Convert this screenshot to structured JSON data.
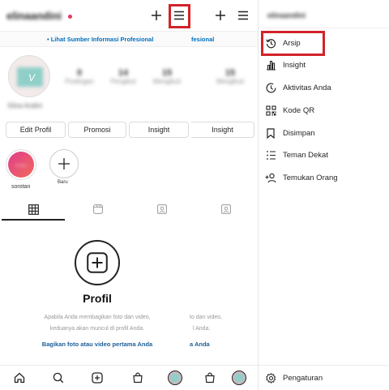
{
  "header": {
    "username": "elinaandini",
    "username_right": "elinaandini"
  },
  "banner": {
    "text": "• Lihat Sumber Informasi Profesional",
    "text_partial": "fesional"
  },
  "profile": {
    "name": "Elina Andini",
    "stats": [
      {
        "num": "0",
        "label": "Postingan"
      },
      {
        "num": "14",
        "label": "Pengikut"
      },
      {
        "num": "15",
        "label": "Mengikuti"
      },
      {
        "num": "15",
        "label": "Mengikuti"
      }
    ]
  },
  "buttons": {
    "edit": "Edit Profil",
    "promo": "Promosi",
    "insight": "Insight",
    "insight2": "Insight"
  },
  "highlights": {
    "saved_label": "sorotan",
    "new_label": "Baru",
    "cover_text": "Sorotan"
  },
  "empty": {
    "title": "Profil",
    "desc1": "Apabila Anda membagikan foto dan video,",
    "desc2": "keduanya akan muncul di profil Anda.",
    "link": "Bagikan foto atau video pertama Anda",
    "desc1_partial": "to dan video,",
    "desc2_partial": "l Anda.",
    "link_partial": "a Anda"
  },
  "menu": {
    "items": [
      {
        "label": "Arsip",
        "icon": "archive-icon"
      },
      {
        "label": "Insight",
        "icon": "insight-icon"
      },
      {
        "label": "Aktivitas Anda",
        "icon": "activity-icon"
      },
      {
        "label": "Kode QR",
        "icon": "qr-code-icon"
      },
      {
        "label": "Disimpan",
        "icon": "bookmark-icon"
      },
      {
        "label": "Teman Dekat",
        "icon": "close-friends-icon"
      },
      {
        "label": "Temukan Orang",
        "icon": "discover-people-icon"
      }
    ],
    "settings": "Pengaturan"
  },
  "colors": {
    "highlight": "#d1232a",
    "link": "#00376b",
    "banner": "#0095f6"
  }
}
